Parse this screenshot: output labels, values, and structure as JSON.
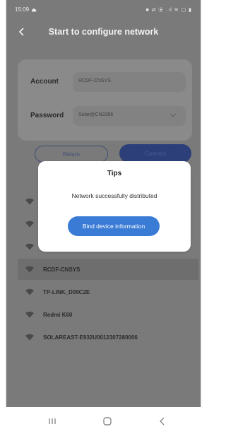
{
  "status_bar": {
    "time": "15:09",
    "icons": "■ ⇄ ⦿ .ıl ≋ ▢ ▮"
  },
  "header": {
    "title": "Start to configure network"
  },
  "form": {
    "account_label": "Account",
    "account_value": "RCDF-CNSYS",
    "password_label": "Password",
    "password_value": "Solar@CN3366"
  },
  "buttons": {
    "return_label": "Return",
    "connect_label": "Connect"
  },
  "wifi_list": [
    {
      "name": "",
      "selected": false
    },
    {
      "name": "",
      "selected": false
    },
    {
      "name": "",
      "selected": false
    },
    {
      "name": "RCDF-CNSYS",
      "selected": true
    },
    {
      "name": "TP-LINK_D09C2E",
      "selected": false
    },
    {
      "name": "Redmi K60",
      "selected": false
    },
    {
      "name": "SOLAREAST-E932U0012307280006",
      "selected": false
    }
  ],
  "modal": {
    "title": "Tips",
    "message": "Network successfully distributed",
    "button_label": "Bind device information"
  },
  "colors": {
    "accent": "#3a7bd5",
    "overlay": "#7a7a7a",
    "connect": "#2c3f78"
  },
  "icons": {
    "back": "chevron-left-icon",
    "wifi": "wifi-icon",
    "dropdown": "chevron-down-icon",
    "nav_recents": "recents-icon",
    "nav_home": "home-icon",
    "nav_back": "back-arrow-icon"
  }
}
